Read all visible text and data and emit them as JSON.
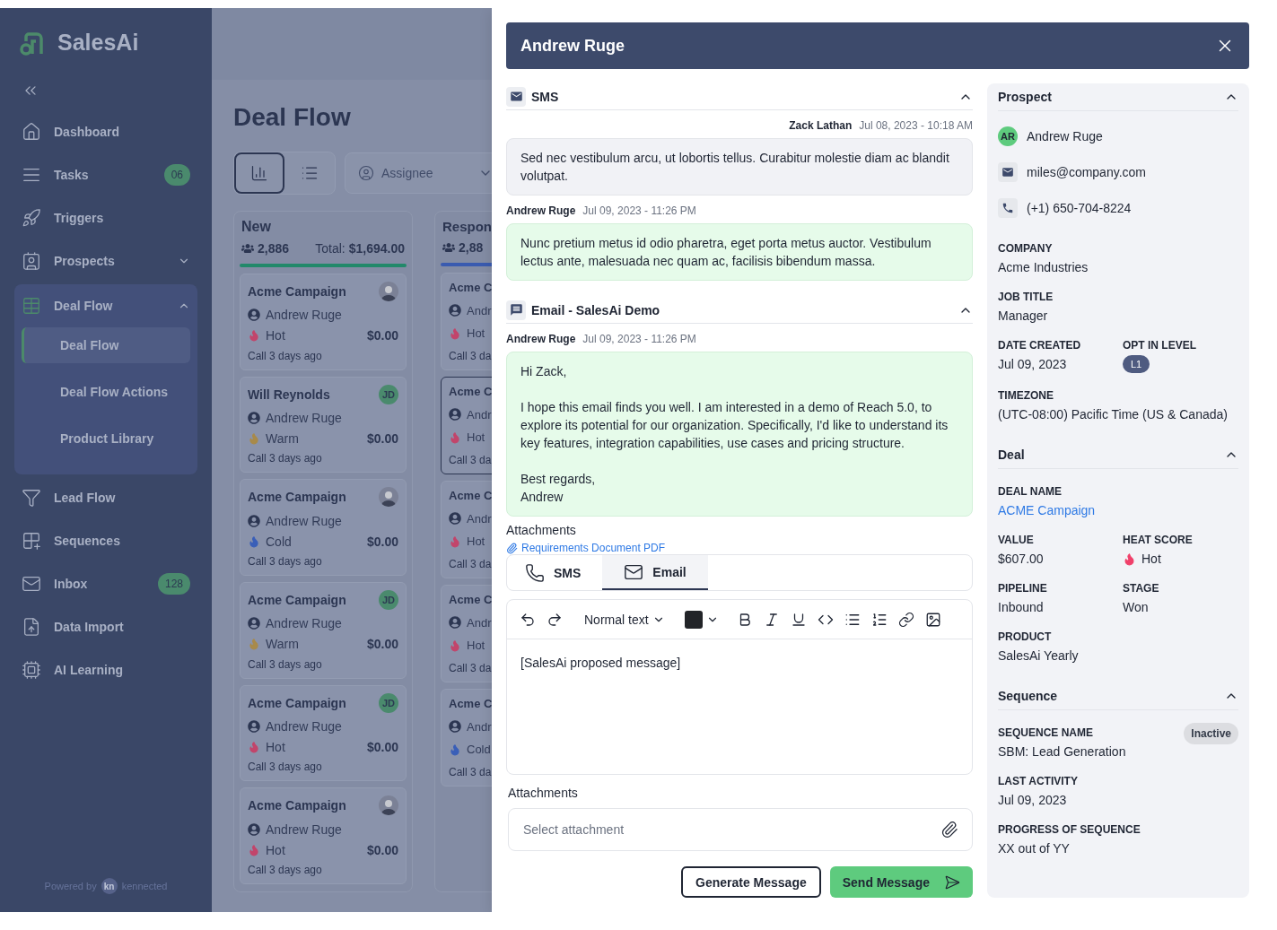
{
  "sidebar": {
    "brand": "SalesAi",
    "items": [
      {
        "label": "Dashboard",
        "kind": "home"
      },
      {
        "label": "Tasks",
        "kind": "tasks",
        "badge": "06"
      },
      {
        "label": "Triggers",
        "kind": "triggers"
      },
      {
        "label": "Prospects",
        "kind": "prospects",
        "expanded": false
      },
      {
        "label": "Deal Flow",
        "kind": "dealflow",
        "expanded": true,
        "children": [
          {
            "label": "Deal Flow",
            "selected": true
          },
          {
            "label": "Deal Flow Actions",
            "selected": false
          },
          {
            "label": "Product Library",
            "selected": false
          }
        ]
      },
      {
        "label": "Lead Flow",
        "kind": "leadflow"
      },
      {
        "label": "Sequences",
        "kind": "sequences"
      },
      {
        "label": "Inbox",
        "kind": "inbox",
        "badge": "128"
      },
      {
        "label": "Data Import",
        "kind": "import"
      },
      {
        "label": "AI Learning",
        "kind": "ai"
      }
    ],
    "footer": {
      "text": "Powered by",
      "logo_mark": "kn",
      "logo_text": "kennected"
    }
  },
  "board": {
    "title": "Deal Flow",
    "views": [
      {
        "kind": "board",
        "selected": true
      },
      {
        "kind": "list",
        "selected": false
      }
    ],
    "assignee_filter": {
      "label": "Assignee"
    },
    "columns": [
      {
        "title": "New",
        "count": "2,886",
        "total_label": "Total:",
        "total": "$1,694.00",
        "color": "#22896a",
        "clipped": false,
        "cards": [
          {
            "title": "Acme Campaign",
            "assignee": "Andrew Ruge",
            "heat": {
              "label": "Hot",
              "kind": "hot"
            },
            "value": "$0.00",
            "activity": "Call 3 days ago",
            "avatar": {
              "kind": "photo"
            },
            "selected": false
          },
          {
            "title": "Will Reynolds",
            "assignee": "Andrew Ruge",
            "heat": {
              "label": "Warm",
              "kind": "warm"
            },
            "value": "$0.00",
            "activity": "Call 3 days ago",
            "avatar": {
              "kind": "initials",
              "text": "JD"
            },
            "selected": false
          },
          {
            "title": "Acme Campaign",
            "assignee": "Andrew Ruge",
            "heat": {
              "label": "Cold",
              "kind": "cold"
            },
            "value": "$0.00",
            "activity": "Call 3 days ago",
            "avatar": {
              "kind": "photo"
            },
            "selected": false
          },
          {
            "title": "Acme Campaign",
            "assignee": "Andrew Ruge",
            "heat": {
              "label": "Warm",
              "kind": "warm"
            },
            "value": "$0.00",
            "activity": "Call 3 days ago",
            "avatar": {
              "kind": "initials",
              "text": "JD"
            },
            "selected": false
          },
          {
            "title": "Acme Campaign",
            "assignee": "Andrew Ruge",
            "heat": {
              "label": "Hot",
              "kind": "hot"
            },
            "value": "$0.00",
            "activity": "Call 3 days ago",
            "avatar": {
              "kind": "initials",
              "text": "JD"
            },
            "selected": false
          },
          {
            "title": "Acme Campaign",
            "assignee": "Andrew Ruge",
            "heat": {
              "label": "Hot",
              "kind": "hot"
            },
            "value": "$0.00",
            "activity": "Call 3 days ago",
            "avatar": {
              "kind": "photo"
            },
            "selected": false
          }
        ]
      },
      {
        "title": "Respon",
        "count": "2,88",
        "color": "#3a5bb0",
        "clipped": true,
        "cards": [
          {
            "title": "Acme C",
            "assignee": "Andr",
            "heat": {
              "label": "Hot",
              "kind": "hot"
            },
            "activity": "Call 3 da",
            "selected": false
          },
          {
            "title": "Acme C",
            "assignee": "Andr",
            "heat": {
              "label": "Hot",
              "kind": "hot"
            },
            "activity": "Call 3 da",
            "selected": true
          },
          {
            "title": "Acme C",
            "assignee": "Andr",
            "heat": {
              "label": "Hot",
              "kind": "hot"
            },
            "activity": "Call 3 da",
            "selected": false
          },
          {
            "title": "Acme C",
            "assignee": "Andr",
            "heat": {
              "label": "Hot",
              "kind": "hot"
            },
            "activity": "Call 3 da",
            "selected": false
          },
          {
            "title": "Acme C",
            "assignee": "Andr",
            "heat": {
              "label": "Cold",
              "kind": "cold"
            },
            "activity": "Call 3 da",
            "selected": false
          }
        ]
      }
    ]
  },
  "modal": {
    "title": "Andrew Ruge",
    "threads": [
      {
        "kind": "sms",
        "title": "SMS",
        "expanded": true,
        "messages": [
          {
            "sender": "Zack Lathan",
            "time": "Jul 08, 2023 - 10:18 AM",
            "outgoing": true,
            "text": "Sed nec vestibulum arcu, ut lobortis tellus. Curabitur molestie diam ac blandit volutpat."
          },
          {
            "sender": "Andrew Ruge",
            "time": "Jul 09, 2023 - 11:26 PM",
            "outgoing": false,
            "text": "Nunc pretium metus id odio pharetra, eget porta metus auctor. Vestibulum lectus ante, malesuada nec quam ac, facilisis bibendum massa."
          }
        ]
      },
      {
        "kind": "email",
        "title": "Email - SalesAi Demo",
        "expanded": true,
        "messages": [
          {
            "sender": "Andrew Ruge",
            "time": "Jul 09, 2023 - 11:26 PM",
            "outgoing": false,
            "text": "Hi Zack,\n\nI hope this email finds you well. I am interested in a demo of Reach 5.0, to explore its potential for our organization. Specifically, I'd like to understand its key features, integration capabilities, use cases and pricing structure.\n\nBest regards,\nAndrew"
          }
        ],
        "attachments_label": "Attachments",
        "attachments": [
          "Requirements Document PDF"
        ]
      }
    ],
    "composer": {
      "tabs": [
        {
          "label": "SMS",
          "kind": "sms",
          "selected": false
        },
        {
          "label": "Email",
          "kind": "email",
          "selected": true
        }
      ],
      "toolbar": [
        {
          "kind": "undo"
        },
        {
          "kind": "redo"
        },
        {
          "kind": "text-style",
          "label": "Normal text"
        },
        {
          "kind": "color",
          "color": "#222428"
        },
        {
          "kind": "bold"
        },
        {
          "kind": "italic"
        },
        {
          "kind": "underline"
        },
        {
          "kind": "code"
        },
        {
          "kind": "bullets"
        },
        {
          "kind": "numbers"
        },
        {
          "kind": "link"
        },
        {
          "kind": "image"
        }
      ],
      "body": "[SalesAi proposed message]",
      "attachments_label": "Attachments",
      "attachment_field": {
        "placeholder": "Select attachment"
      },
      "buttons": [
        {
          "label": "Generate Message",
          "kind": "secondary"
        },
        {
          "label": "Send Message",
          "kind": "primary"
        }
      ]
    },
    "details": [
      {
        "title": "Prospect",
        "expanded": true,
        "contacts": [
          {
            "kind": "avatar",
            "initials": "AR",
            "text": "Andrew Ruge"
          },
          {
            "kind": "email",
            "text": "miles@company.com"
          },
          {
            "kind": "phone",
            "text": "(+1) 650-704-8224"
          }
        ],
        "rows": [
          [
            {
              "label": "COMPANY",
              "value": "Acme Industries"
            }
          ],
          [
            {
              "label": "JOB TITLE",
              "value": "Manager"
            }
          ],
          [
            {
              "label": "DATE CREATED",
              "value": "Jul 09, 2023"
            },
            {
              "label": "OPT IN LEVEL",
              "value": "L1",
              "kind": "badge"
            }
          ],
          [
            {
              "label": "TIMEZONE",
              "value": "(UTC-08:00) Pacific Time (US & Canada)"
            }
          ]
        ]
      },
      {
        "title": "Deal",
        "expanded": true,
        "rows": [
          [
            {
              "label": "DEAL NAME",
              "value": "ACME Campaign",
              "kind": "link"
            }
          ],
          [
            {
              "label": "VALUE",
              "value": "$607.00"
            },
            {
              "label": "HEAT SCORE",
              "value": "Hot",
              "kind": "heat"
            }
          ],
          [
            {
              "label": "PIPELINE",
              "value": "Inbound"
            },
            {
              "label": "STAGE",
              "value": "Won"
            }
          ],
          [
            {
              "label": "PRODUCT",
              "value": "SalesAi Yearly"
            }
          ]
        ]
      },
      {
        "title": "Sequence",
        "expanded": true,
        "rows": [
          [
            {
              "label": "SEQUENCE NAME",
              "value": "SBM: Lead Generation",
              "status": "Inactive"
            }
          ],
          [
            {
              "label": "LAST ACTIVITY",
              "value": "Jul 09, 2023"
            }
          ],
          [
            {
              "label": "PROGRESS OF SEQUENCE",
              "value": "XX out of YY"
            }
          ]
        ]
      }
    ]
  }
}
